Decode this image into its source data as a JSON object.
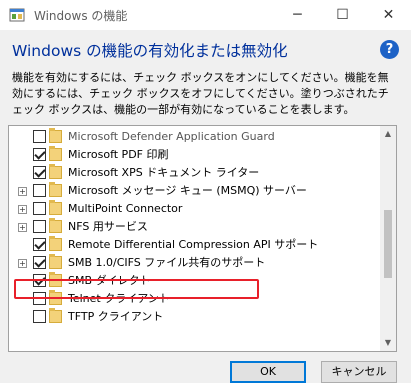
{
  "window": {
    "title": "Windows の機能",
    "minimize_glyph": "─",
    "maximize_glyph": "☐",
    "close_glyph": "✕"
  },
  "heading": "Windows の機能の有効化または無効化",
  "help_glyph": "?",
  "description": "機能を有効にするには、チェック ボックスをオンにしてください。機能を無効にするには、チェック ボックスをオフにしてください。塗りつぶされたチェック ボックスは、機能の一部が有効になっていることを表します。",
  "features": [
    {
      "label": "Microsoft Defender Application Guard",
      "checked": false,
      "expandable": false,
      "dimmed": true
    },
    {
      "label": "Microsoft PDF 印刷",
      "checked": true,
      "expandable": false,
      "dimmed": false
    },
    {
      "label": "Microsoft XPS ドキュメント ライター",
      "checked": true,
      "expandable": false,
      "dimmed": false
    },
    {
      "label": "Microsoft メッセージ キュー (MSMQ) サーバー",
      "checked": false,
      "expandable": true,
      "dimmed": false
    },
    {
      "label": "MultiPoint Connector",
      "checked": false,
      "expandable": true,
      "dimmed": false
    },
    {
      "label": "NFS 用サービス",
      "checked": false,
      "expandable": true,
      "dimmed": false
    },
    {
      "label": "Remote Differential Compression API サポート",
      "checked": true,
      "expandable": false,
      "dimmed": false
    },
    {
      "label": "SMB 1.0/CIFS ファイル共有のサポート",
      "checked": true,
      "expandable": true,
      "dimmed": false,
      "highlighted": true
    },
    {
      "label": "SMB ダイレクト",
      "checked": true,
      "expandable": false,
      "dimmed": false
    },
    {
      "label": "Telnet クライアント",
      "checked": false,
      "expandable": false,
      "dimmed": false
    },
    {
      "label": "TFTP クライアント",
      "checked": false,
      "expandable": false,
      "dimmed": false
    }
  ],
  "scrollbar": {
    "up_glyph": "▲",
    "down_glyph": "▼"
  },
  "buttons": {
    "ok": "OK",
    "cancel": "キャンセル"
  },
  "colors": {
    "heading": "#00309c",
    "highlight": "#e8202a",
    "ok_border": "#0078d7"
  }
}
